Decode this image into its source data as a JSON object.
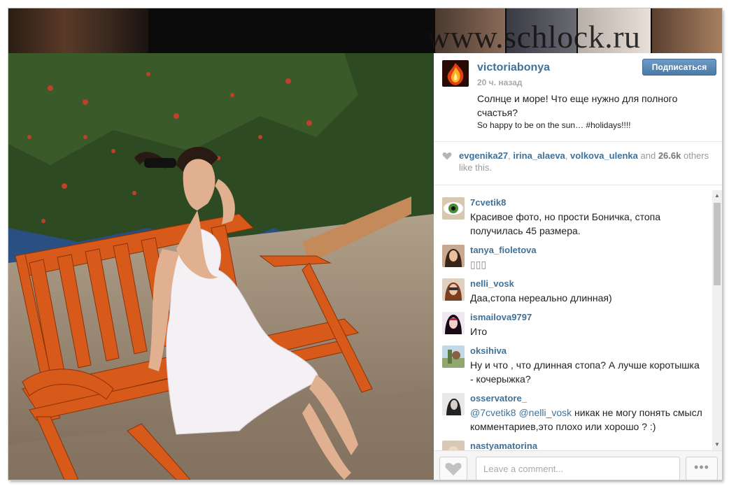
{
  "watermark": "www.schlock.ru",
  "post": {
    "username": "victoriabonya",
    "time": "20 ч. назад",
    "follow_label": "Подписаться",
    "caption_ru": "Солнце и море! Что еще нужно для полного счастья?",
    "caption_en": "So happy to be on the sun… #holidays!!!!"
  },
  "likes": {
    "users": [
      "evgenika27",
      "irina_alaeva",
      "volkova_ulenka"
    ],
    "and_text": "and",
    "count": "26.6k",
    "suffix": "others like this."
  },
  "comments": [
    {
      "user": "7cvetik8",
      "text": "Красивое фото, но прости Боничка, стопа получилась 45 размера."
    },
    {
      "user": "tanya_fioletova",
      "text": "▯▯▯"
    },
    {
      "user": "nelli_vosk",
      "text": "Даа,стопа нереально длинная)"
    },
    {
      "user": "ismailova9797",
      "text": "Ито"
    },
    {
      "user": "oksihiva",
      "text": "Ну и что , что длинная стопа? А лучше коротышка - кочерыжка?"
    },
    {
      "user": "osservatore_",
      "text": "@7cvetik8 @nelli_vosk никак не могу понять смысл комментариев,это плохо или хорошо ? :)"
    },
    {
      "user": "nastyamatorina",
      "text": ""
    }
  ],
  "footer": {
    "comment_placeholder": "Leave a comment...",
    "more_label": "•••"
  },
  "colors": {
    "username": "#3f729b",
    "follow_button": "#4b7aa8"
  }
}
